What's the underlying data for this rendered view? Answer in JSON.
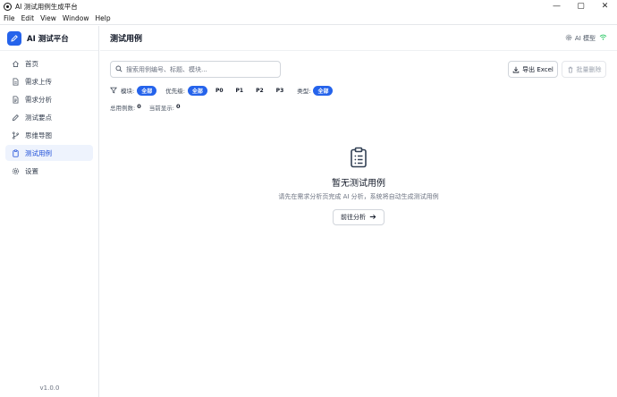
{
  "window": {
    "title": "AI 测试用例生成平台",
    "controls": [
      "—",
      "▢",
      "✕"
    ]
  },
  "menu": [
    "File",
    "Edit",
    "View",
    "Window",
    "Help"
  ],
  "sidebar": {
    "brand": "AI 测试平台",
    "items": [
      {
        "label": "首页",
        "icon": "home-icon",
        "active": false
      },
      {
        "label": "需求上传",
        "icon": "document-upload-icon",
        "active": false
      },
      {
        "label": "需求分析",
        "icon": "analysis-icon",
        "active": false
      },
      {
        "label": "测试要点",
        "icon": "pen-icon",
        "active": false
      },
      {
        "label": "思维导图",
        "icon": "branch-icon",
        "active": false
      },
      {
        "label": "测试用例",
        "icon": "clipboard-icon",
        "active": true
      },
      {
        "label": "设置",
        "icon": "gear-icon",
        "active": false
      }
    ],
    "version": "v1.0.0"
  },
  "header": {
    "title": "测试用例",
    "model_label": "AI 模型",
    "status_color": "#22c55e"
  },
  "toolbar": {
    "search_placeholder": "搜索用例编号、标题、模块...",
    "export_label": "导出 Excel",
    "delete_label": "批量删除"
  },
  "filters": {
    "module_label": "模块:",
    "module_options": [
      "全部"
    ],
    "priority_label": "优先级:",
    "priority_options": [
      "全部",
      "P0",
      "P1",
      "P2",
      "P3"
    ],
    "type_label": "类型:",
    "type_options": [
      "全部"
    ]
  },
  "stats": {
    "total_label": "总用例数:",
    "total": "0",
    "shown_label": "当前显示:",
    "shown": "0"
  },
  "empty": {
    "title": "暂无测试用例",
    "description": "请先在需求分析页完成 AI 分析，系统将自动生成测试用例",
    "button": "前往分析"
  },
  "colors": {
    "accent": "#2563eb",
    "active_bg": "#eef3fd"
  }
}
